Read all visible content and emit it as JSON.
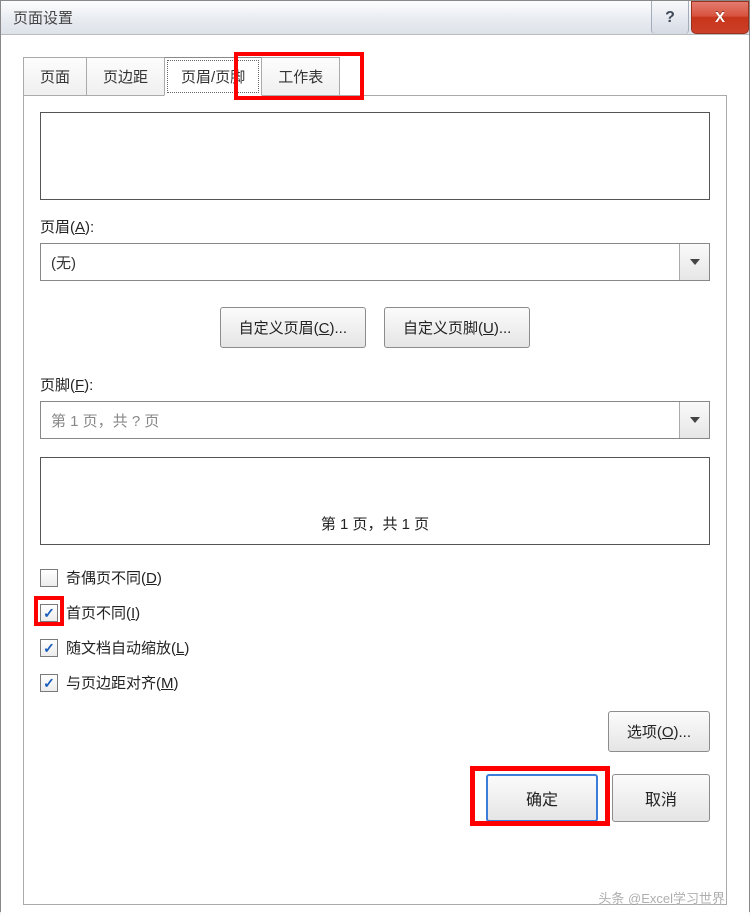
{
  "window": {
    "title": "页面设置",
    "help_glyph": "?",
    "close_glyph": "X"
  },
  "tabs": {
    "page": "页面",
    "margins": "页边距",
    "header_footer": "页眉/页脚",
    "sheet": "工作表"
  },
  "labels": {
    "header": "页眉(",
    "header_accel": "A",
    "header_suffix": "):",
    "footer": "页脚(",
    "footer_accel": "F",
    "footer_suffix": "):"
  },
  "dropdowns": {
    "header_value": "(无)",
    "footer_value": "第 1 页，共 ? 页"
  },
  "buttons": {
    "custom_header": "自定义页眉(",
    "custom_header_accel": "C",
    "custom_header_suffix": ")...",
    "custom_footer": "自定义页脚(",
    "custom_footer_accel": "U",
    "custom_footer_suffix": ")...",
    "options": "选项(",
    "options_accel": "O",
    "options_suffix": ")...",
    "ok": "确定",
    "cancel": "取消"
  },
  "footer_preview_text": "第 1 页，共 1 页",
  "checkboxes": {
    "diff_odd_even": {
      "label": "奇偶页不同(",
      "accel": "D",
      "suffix": ")",
      "checked": false
    },
    "diff_first": {
      "label": "首页不同(",
      "accel": "I",
      "suffix": ")",
      "checked": true
    },
    "scale_with_doc": {
      "label": "随文档自动缩放(",
      "accel": "L",
      "suffix": ")",
      "checked": true
    },
    "align_margins": {
      "label": "与页边距对齐(",
      "accel": "M",
      "suffix": ")",
      "checked": true
    }
  },
  "watermark": "头条 @Excel学习世界"
}
